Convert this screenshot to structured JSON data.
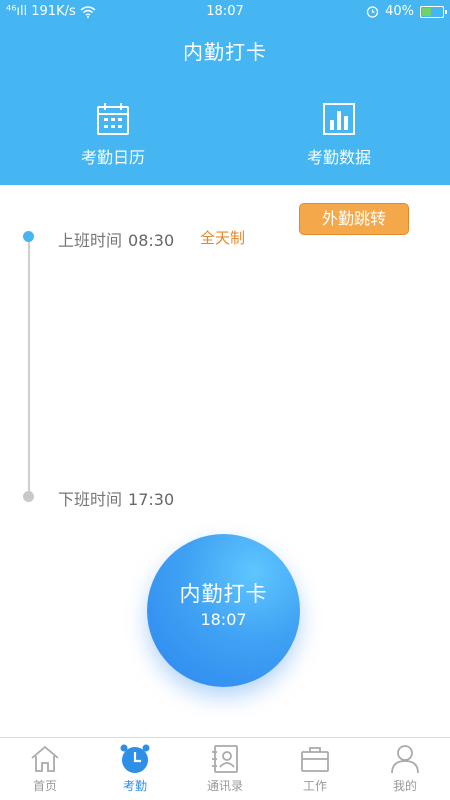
{
  "status_bar": {
    "network": "⁴⁶ıll",
    "speed": "191K/s",
    "time": "18:07",
    "battery": "40%",
    "battery_level": 0.4
  },
  "header": {
    "title": "内勤打卡",
    "calendar_label": "考勤日历",
    "data_label": "考勤数据"
  },
  "main": {
    "outside_button": "外勤跳转",
    "start_label": "上班时间",
    "start_time": "08:30",
    "schedule_type": "全天制",
    "end_label": "下班时间",
    "end_time": "17:30",
    "punch_title": "内勤打卡",
    "punch_time": "18:07"
  },
  "bottom_nav": {
    "items": [
      {
        "label": "首页",
        "icon": "home-icon"
      },
      {
        "label": "考勤",
        "icon": "alarm-clock-icon"
      },
      {
        "label": "通讯录",
        "icon": "contacts-icon"
      },
      {
        "label": "工作",
        "icon": "briefcase-icon"
      },
      {
        "label": "我的",
        "icon": "user-icon"
      }
    ],
    "active_index": 1
  },
  "colors": {
    "header_bg": "#45b6f1",
    "accent_orange": "#f5a84a",
    "punch_blue": "#2c86ef",
    "active_nav": "#2d8fe6"
  }
}
